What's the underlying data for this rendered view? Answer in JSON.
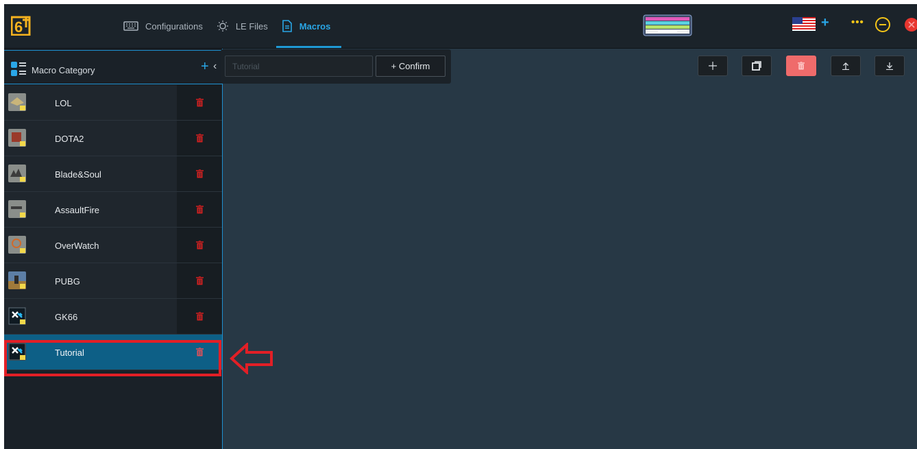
{
  "nav": {
    "items": [
      {
        "label": "Configurations",
        "icon": "keyboard-icon"
      },
      {
        "label": "LE Files",
        "icon": "light-bulb-icon"
      },
      {
        "label": "Macros",
        "icon": "document-icon",
        "active": true
      }
    ]
  },
  "sidebar": {
    "title": "Macro Category",
    "items": [
      {
        "label": "LOL"
      },
      {
        "label": "DOTA2"
      },
      {
        "label": "Blade&Soul"
      },
      {
        "label": "AssaultFire"
      },
      {
        "label": "OverWatch"
      },
      {
        "label": "PUBG"
      },
      {
        "label": "GK66"
      },
      {
        "label": "Tutorial",
        "selected": true
      }
    ]
  },
  "popup": {
    "placeholder": "Tutorial",
    "confirm_label": "+ Confirm"
  },
  "colors": {
    "accent": "#1f9ad6",
    "danger": "#ef6b6b",
    "selected_row": "#0d5f86",
    "annotation": "#e21f26"
  }
}
